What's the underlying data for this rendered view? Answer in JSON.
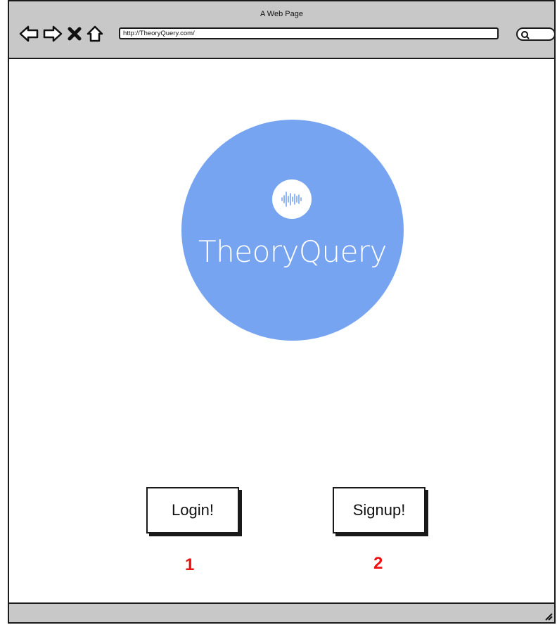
{
  "window": {
    "title": "A Web Page"
  },
  "browser": {
    "url": "http://TheoryQuery.com/",
    "nav_icons": [
      "back-arrow-icon",
      "forward-arrow-icon",
      "stop-icon",
      "home-icon"
    ],
    "search_icon": "search-icon"
  },
  "logo": {
    "text": "TheoryQuery",
    "icon": "audio-waveform-icon",
    "colors": {
      "circle": "#77a4f1",
      "text": "#ffffff"
    }
  },
  "actions": {
    "login_label": "Login!",
    "signup_label": "Signup!"
  },
  "annotations": {
    "login_marker": "1",
    "signup_marker": "2",
    "color": "#ee1111"
  }
}
